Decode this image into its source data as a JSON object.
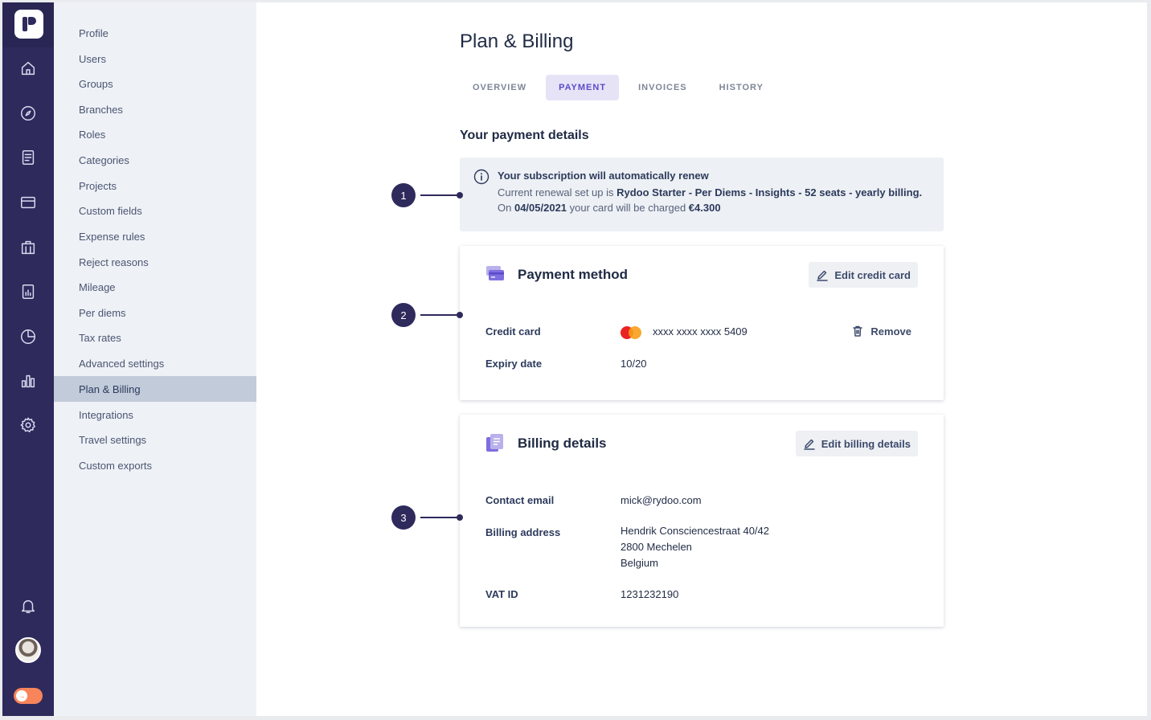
{
  "sidebar": {
    "items": [
      {
        "label": "Profile"
      },
      {
        "label": "Users"
      },
      {
        "label": "Groups"
      },
      {
        "label": "Branches"
      },
      {
        "label": "Roles"
      },
      {
        "label": "Categories"
      },
      {
        "label": "Projects"
      },
      {
        "label": "Custom fields"
      },
      {
        "label": "Expense rules"
      },
      {
        "label": "Reject reasons"
      },
      {
        "label": "Mileage"
      },
      {
        "label": "Per diems"
      },
      {
        "label": "Tax rates"
      },
      {
        "label": "Advanced settings"
      },
      {
        "label": "Plan & Billing",
        "active": true
      },
      {
        "label": "Integrations"
      },
      {
        "label": "Travel settings"
      },
      {
        "label": "Custom exports"
      }
    ]
  },
  "rail": {
    "icons": [
      "home-icon",
      "compass-icon",
      "document-icon",
      "card-icon",
      "building-icon",
      "report-icon",
      "pie-chart-icon",
      "bar-chart-icon",
      "gear-icon"
    ],
    "bottom_icons": [
      "bell-icon",
      "avatar",
      "toggle"
    ]
  },
  "page": {
    "title": "Plan & Billing",
    "tabs": [
      {
        "label": "OVERVIEW"
      },
      {
        "label": "PAYMENT",
        "active": true
      },
      {
        "label": "INVOICES"
      },
      {
        "label": "HISTORY"
      }
    ],
    "section_title": "Your payment details"
  },
  "notice": {
    "title": "Your subscription will automatically renew",
    "line1_prefix": "Current renewal set up is ",
    "line1_bold": "Rydoo Starter - Per Diems - Insights - 52 seats - yearly billing.",
    "line2_prefix": "On ",
    "line2_date": "04/05/2021",
    "line2_middle": " your card will be charged ",
    "line2_amount": "€4.300"
  },
  "payment_method": {
    "title": "Payment method",
    "edit_label": "Edit credit card",
    "credit_card_label": "Credit card",
    "card_number": "xxxx xxxx xxxx 5409",
    "remove_label": "Remove",
    "expiry_label": "Expiry date",
    "expiry_value": "10/20"
  },
  "billing_details": {
    "title": "Billing details",
    "edit_label": "Edit billing details",
    "contact_email_label": "Contact email",
    "contact_email": "mick@rydoo.com",
    "address_label": "Billing address",
    "address_line1": "Hendrik Consciencestraat 40/42",
    "address_line2": "2800 Mechelen",
    "address_line3": "Belgium",
    "vat_label": "VAT ID",
    "vat_value": "1231232190"
  },
  "callouts": [
    "1",
    "2",
    "3"
  ],
  "colors": {
    "rail": "#2e2a5c",
    "subnav": "#eef1f6",
    "active_tab": "#5c4bc8",
    "notice_bg": "#edf0f4"
  }
}
